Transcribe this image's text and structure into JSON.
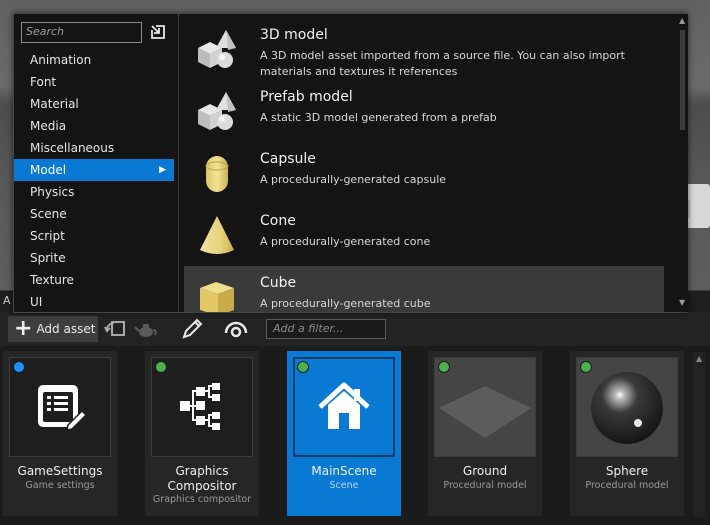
{
  "popup": {
    "search_placeholder": "Search",
    "categories": [
      {
        "label": "Animation"
      },
      {
        "label": "Font"
      },
      {
        "label": "Material"
      },
      {
        "label": "Media"
      },
      {
        "label": "Miscellaneous"
      },
      {
        "label": "Model",
        "active": true
      },
      {
        "label": "Physics"
      },
      {
        "label": "Scene"
      },
      {
        "label": "Script"
      },
      {
        "label": "Sprite"
      },
      {
        "label": "Texture"
      },
      {
        "label": "UI"
      }
    ],
    "items": [
      {
        "title": "3D model",
        "desc": "A 3D model asset imported from a source file. You can also import materials and textures it references",
        "icon": "3d-model-icon"
      },
      {
        "title": "Prefab model",
        "desc": "A static 3D model generated from a prefab",
        "icon": "prefab-model-icon"
      },
      {
        "title": "Capsule",
        "desc": "A procedurally-generated capsule",
        "icon": "capsule-icon"
      },
      {
        "title": "Cone",
        "desc": "A procedurally-generated cone",
        "icon": "cone-icon"
      },
      {
        "title": "Cube",
        "desc": "A procedurally-generated cube",
        "icon": "cube-icon"
      }
    ]
  },
  "asset_panel": {
    "header_letter": "A",
    "add_asset_label": "Add asset",
    "filter_placeholder": "Add a filter...",
    "assets": [
      {
        "name": "GameSettings",
        "type": "Game settings",
        "status_color": "#1e90ff",
        "icon": "game-settings-icon"
      },
      {
        "name": "Graphics Compositor",
        "type": "Graphics compositor",
        "status_color": "#4caf50",
        "icon": "graphics-compositor-icon"
      },
      {
        "name": "MainScene",
        "type": "Scene",
        "status_color": "#4caf50",
        "icon": "scene-house-icon",
        "selected": true
      },
      {
        "name": "Ground",
        "type": "Procedural model",
        "status_color": "#4caf50",
        "icon": "ground-plane-icon"
      },
      {
        "name": "Sphere",
        "type": "Procedural model",
        "status_color": "#4caf50",
        "icon": "sphere-icon"
      }
    ]
  },
  "colors": {
    "accent": "#0a79d4",
    "status_green": "#4caf50",
    "status_blue": "#1e90ff"
  }
}
